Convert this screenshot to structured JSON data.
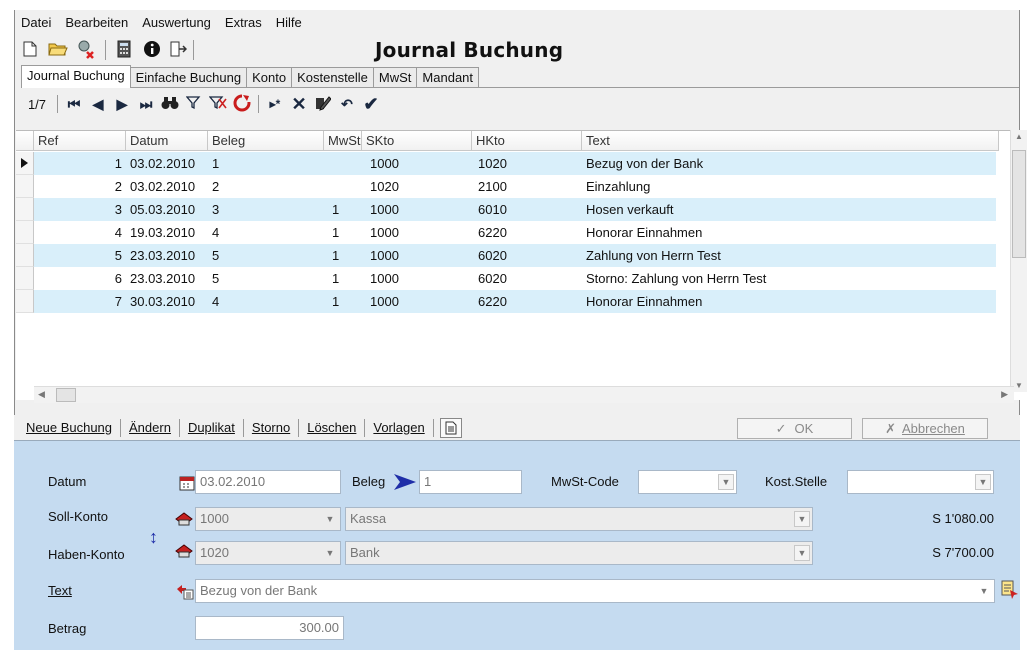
{
  "menu": [
    "Datei",
    "Bearbeiten",
    "Auswertung",
    "Extras",
    "Hilfe"
  ],
  "app_title": "Journal Buchung",
  "tabs": [
    "Journal Buchung",
    "Einfache Buchung",
    "Konto",
    "Kostenstelle",
    "MwSt",
    "Mandant"
  ],
  "record_position": "1/7",
  "columns": [
    "Ref",
    "Datum",
    "Beleg",
    "MwSt",
    "SKto",
    "HKto",
    "Text"
  ],
  "rows": [
    {
      "ref": "1",
      "datum": "03.02.2010",
      "beleg": "1",
      "mwst": "",
      "skto": "1000",
      "hkto": "1020",
      "text": "Bezug von der Bank"
    },
    {
      "ref": "2",
      "datum": "03.02.2010",
      "beleg": "2",
      "mwst": "",
      "skto": "1020",
      "hkto": "2100",
      "text": "Einzahlung"
    },
    {
      "ref": "3",
      "datum": "05.03.2010",
      "beleg": "3",
      "mwst": "1",
      "skto": "1000",
      "hkto": "6010",
      "text": "Hosen verkauft"
    },
    {
      "ref": "4",
      "datum": "19.03.2010",
      "beleg": "4",
      "mwst": "1",
      "skto": "1000",
      "hkto": "6220",
      "text": "Honorar Einnahmen"
    },
    {
      "ref": "5",
      "datum": "23.03.2010",
      "beleg": "5",
      "mwst": "1",
      "skto": "1000",
      "hkto": "6020",
      "text": "Zahlung von Herrn Test"
    },
    {
      "ref": "6",
      "datum": "23.03.2010",
      "beleg": "5",
      "mwst": "1",
      "skto": "1000",
      "hkto": "6020",
      "text": "Storno: Zahlung von Herrn Test"
    },
    {
      "ref": "7",
      "datum": "30.03.2010",
      "beleg": "4",
      "mwst": "1",
      "skto": "1000",
      "hkto": "6220",
      "text": "Honorar Einnahmen"
    }
  ],
  "actions": {
    "neue": "Neue Buchung",
    "aendern": "Ändern",
    "duplikat": "Duplikat",
    "storno": "Storno",
    "loeschen": "Löschen",
    "vorlagen": "Vorlagen",
    "ok": "OK",
    "abbrechen": "Abbrechen"
  },
  "form": {
    "datum_label": "Datum",
    "datum_value": "03.02.2010",
    "beleg_label": "Beleg",
    "beleg_value": "1",
    "mwst_label": "MwSt-Code",
    "mwst_value": "",
    "kost_label": "Kost.Stelle",
    "kost_value": "",
    "soll_label": "Soll-Konto",
    "soll_konto": "1000",
    "soll_name": "Kassa",
    "soll_saldo": "S 1'080.00",
    "haben_label": "Haben-Konto",
    "haben_konto": "1020",
    "haben_name": "Bank",
    "haben_saldo": "S 7'700.00",
    "text_label": "Text",
    "text_value": "Bezug von der Bank",
    "betrag_label": "Betrag",
    "betrag_value": "300.00"
  },
  "colors": {
    "row_alt": "#d9effa",
    "form_bg": "#c5dbf0",
    "accent_blue": "#1f2ea8"
  }
}
